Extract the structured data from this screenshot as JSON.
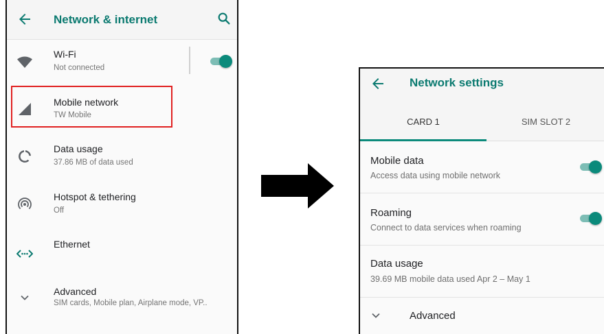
{
  "left_screen": {
    "title": "Network & internet",
    "icons": {
      "back": "arrow-left-icon",
      "search": "search-icon"
    },
    "items": [
      {
        "title": "Wi-Fi",
        "subtitle": "Not connected",
        "icon": "wifi-icon",
        "toggle": true
      },
      {
        "title": "Mobile network",
        "subtitle": "TW Mobile",
        "icon": "signal-icon",
        "highlighted": true
      },
      {
        "title": "Data usage",
        "subtitle": "37.86 MB of data used",
        "icon": "data-usage-icon"
      },
      {
        "title": "Hotspot & tethering",
        "subtitle": "Off",
        "icon": "hotspot-icon"
      },
      {
        "title": "Ethernet",
        "subtitle": "",
        "icon": "ethernet-icon"
      },
      {
        "title": "Advanced",
        "subtitle": "SIM cards, Mobile plan, Airplane mode, VP..",
        "icon": "chevron-down-icon"
      }
    ]
  },
  "arrow": {
    "icon": "arrow-right-icon"
  },
  "right_screen": {
    "title": "Network settings",
    "icons": {
      "back": "arrow-left-icon"
    },
    "tabs": [
      {
        "label": "CARD 1",
        "active": true
      },
      {
        "label": "SIM SLOT 2",
        "active": false
      }
    ],
    "items": [
      {
        "title": "Mobile data",
        "subtitle": "Access data using mobile network",
        "toggle": true
      },
      {
        "title": "Roaming",
        "subtitle": "Connect to data services when roaming",
        "toggle": true
      },
      {
        "title": "Data usage",
        "subtitle": "39.69 MB mobile data used Apr 2 – May 1"
      },
      {
        "title": "Advanced",
        "icon": "chevron-down-icon"
      }
    ]
  },
  "colors": {
    "accent": "#0b7a70",
    "toggle_thumb": "#0b8a7b",
    "toggle_track": "#7dbdb5",
    "highlight": "#e02020"
  }
}
